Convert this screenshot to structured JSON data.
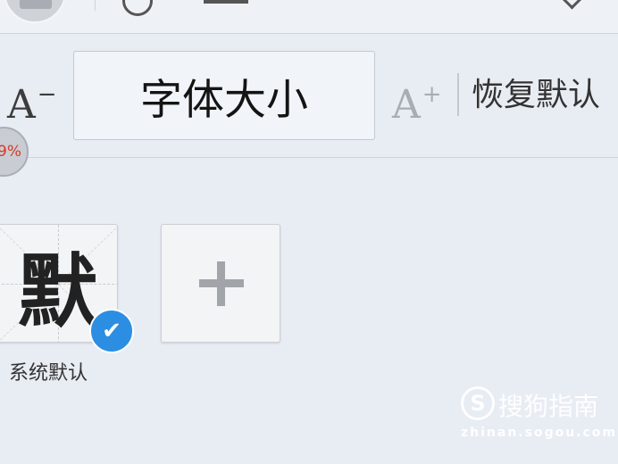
{
  "font_size": {
    "decrease_label": "A",
    "decrease_sign": "−",
    "preview_text": "字体大小",
    "increase_label": "A",
    "increase_sign": "+",
    "reset_label": "恢复默认"
  },
  "progress_badge": {
    "text": "9%"
  },
  "font_choices": [
    {
      "glyph": "默",
      "label": "系统默认",
      "selected": true,
      "check_icon": "check-icon"
    },
    {
      "icon": "plus-icon"
    }
  ],
  "watermark": {
    "logo_letter": "S",
    "brand": "搜狗指南",
    "url": "zhinan.sogou.com"
  },
  "colors": {
    "accent_blue": "#2b8ee2",
    "badge_red": "#d33a2a"
  }
}
